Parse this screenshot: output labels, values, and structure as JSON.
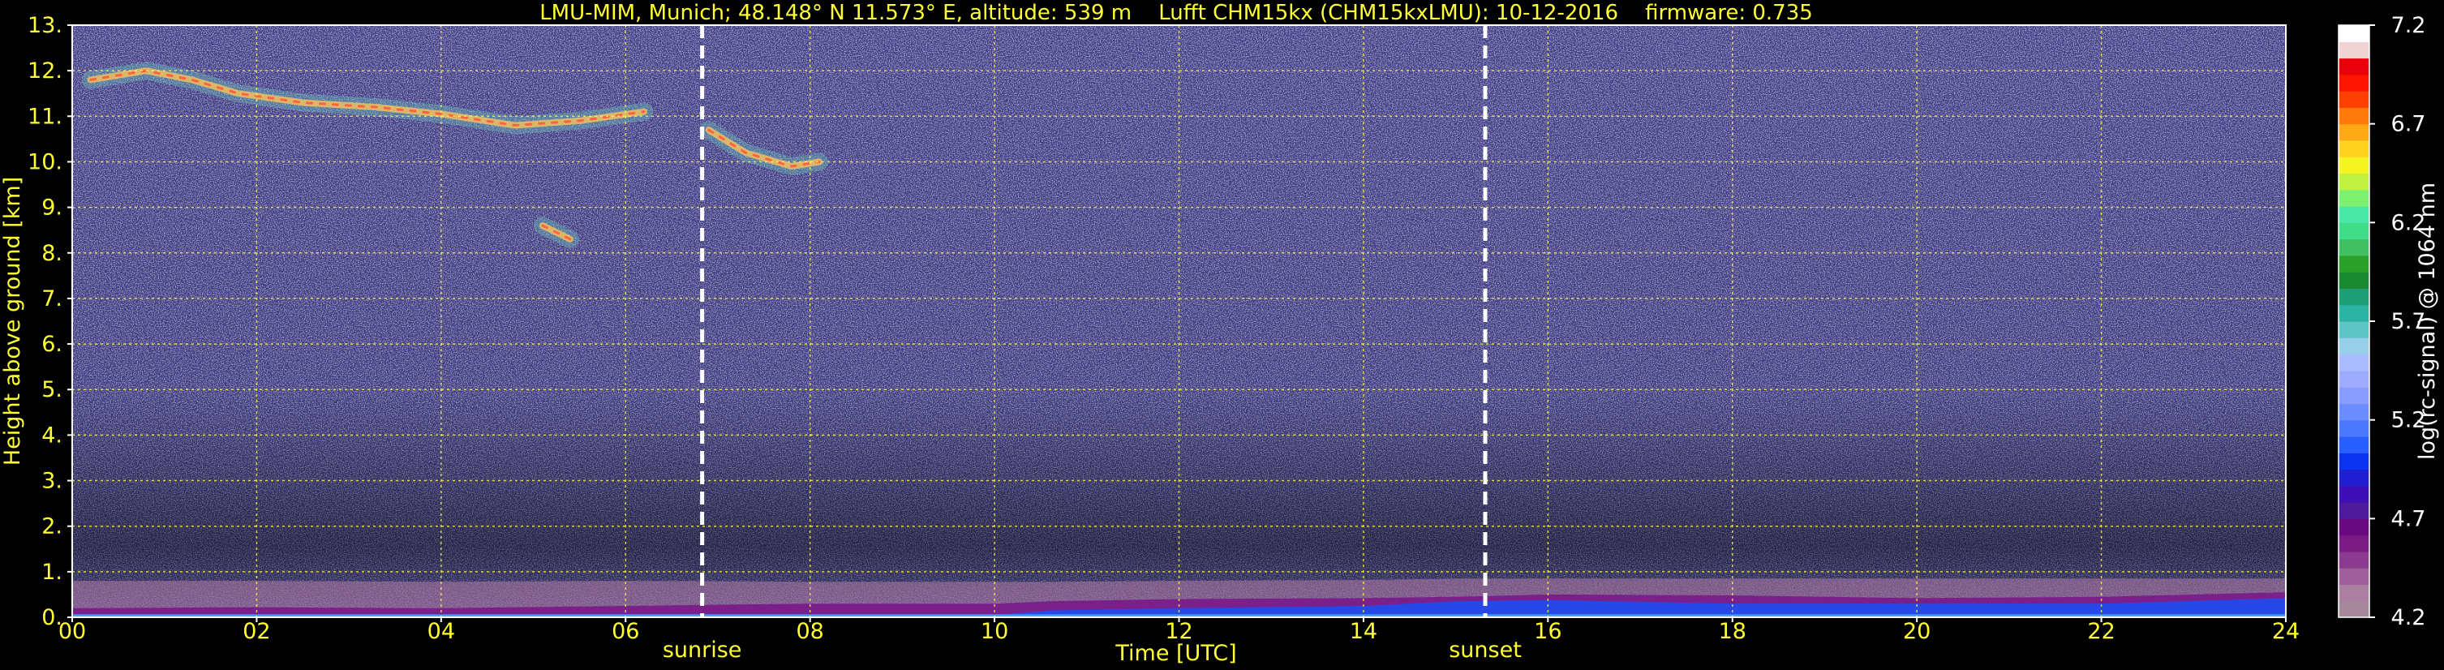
{
  "chart_data": {
    "type": "heatmap",
    "title": "LMU-MIM, Munich; 48.148° N 11.573° E, altitude: 539 m    Lufft CHM15kx (CHM15kxLMU): 10-12-2016    firmware: 0.735",
    "xlabel": "Time [UTC]",
    "ylabel": "Height above ground [km]",
    "xlim": [
      0,
      24
    ],
    "ylim": [
      0,
      13
    ],
    "x_ticks": [
      "00",
      "02",
      "04",
      "06",
      "08",
      "10",
      "12",
      "14",
      "16",
      "18",
      "20",
      "22",
      "24"
    ],
    "y_ticks": [
      "0.",
      "1.",
      "2.",
      "3.",
      "4.",
      "5.",
      "6.",
      "7.",
      "8.",
      "9.",
      "10.",
      "11.",
      "12.",
      "13."
    ],
    "grid": true,
    "grid_color": "#ffff33",
    "annotations": [
      {
        "label": "sunrise",
        "x": 6.83
      },
      {
        "label": "sunset",
        "x": 15.32
      }
    ],
    "colorbar": {
      "label": "log(rc-signal) @ 1064 nm",
      "range": [
        4.2,
        7.2
      ],
      "ticks": [
        "4.2",
        "4.7",
        "5.2",
        "5.7",
        "6.2",
        "6.7",
        "7.2"
      ],
      "colors": [
        "#a5889a",
        "#ab7fa0",
        "#a05e9a",
        "#8a3b8f",
        "#7b1b84",
        "#6a0a80",
        "#4f1a99",
        "#3c10b5",
        "#1f1ed0",
        "#0a32f0",
        "#2860ff",
        "#4a78ff",
        "#6a8cff",
        "#8a9cff",
        "#9eacff",
        "#a9bcff",
        "#98cfe8",
        "#5fc4c4",
        "#2bb3a3",
        "#1e9e74",
        "#1a8a32",
        "#2aa22a",
        "#40c060",
        "#3fdc8a",
        "#49e8a8",
        "#7ef070",
        "#c0f040",
        "#f4f420",
        "#ffd21e",
        "#ffaa14",
        "#ff7a0a",
        "#ff4000",
        "#ff1400",
        "#e8000a",
        "#f0d4d4",
        "#ffffff"
      ]
    },
    "series": [
      {
        "feature": "cirrus",
        "points": [
          [
            0.2,
            11.8
          ],
          [
            0.8,
            12.0
          ],
          [
            1.3,
            11.8
          ],
          [
            1.8,
            11.5
          ],
          [
            2.5,
            11.3
          ],
          [
            3.3,
            11.2
          ],
          [
            4.0,
            11.05
          ],
          [
            4.8,
            10.8
          ],
          [
            5.5,
            10.9
          ],
          [
            6.2,
            11.1
          ]
        ]
      },
      {
        "feature": "cirrus",
        "points": [
          [
            6.9,
            10.7
          ],
          [
            7.3,
            10.2
          ],
          [
            7.8,
            9.9
          ],
          [
            8.1,
            10.0
          ]
        ]
      },
      {
        "feature": "cirrus",
        "points": [
          [
            5.1,
            8.6
          ],
          [
            5.4,
            8.3
          ]
        ]
      },
      {
        "feature": "boundary_layer",
        "x": [
          0,
          2,
          4,
          6,
          8,
          10,
          10.6,
          12,
          14,
          15,
          16,
          18,
          20,
          22,
          24
        ],
        "aerosol_top_km": [
          0.8,
          0.8,
          0.78,
          0.8,
          0.78,
          0.78,
          0.78,
          0.8,
          0.82,
          0.85,
          0.85,
          0.85,
          0.85,
          0.85,
          0.85
        ],
        "dense_top_km": [
          0.2,
          0.22,
          0.2,
          0.25,
          0.3,
          0.3,
          0.35,
          0.4,
          0.42,
          0.45,
          0.5,
          0.48,
          0.42,
          0.45,
          0.55
        ],
        "blue_layer_km": [
          0.0,
          0.0,
          0.0,
          0.0,
          0.0,
          0.05,
          0.15,
          0.2,
          0.25,
          0.35,
          0.38,
          0.3,
          0.3,
          0.3,
          0.42
        ]
      }
    ]
  }
}
